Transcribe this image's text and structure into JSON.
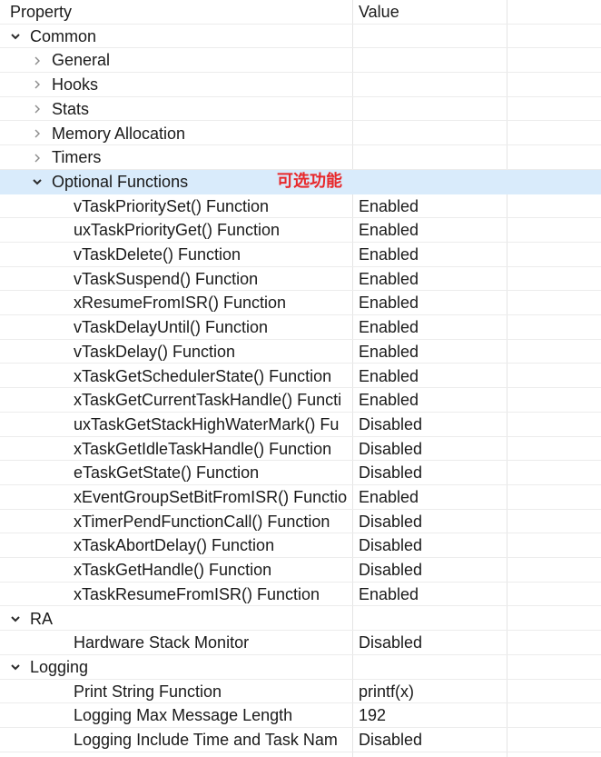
{
  "header": {
    "property": "Property",
    "value": "Value"
  },
  "annotation": {
    "text": "可选功能",
    "color": "#e8282b"
  },
  "rows": [
    {
      "label": "Common",
      "value": "",
      "depth": 0,
      "chevron": "expanded"
    },
    {
      "label": "General",
      "value": "",
      "depth": 1,
      "chevron": "collapsed"
    },
    {
      "label": "Hooks",
      "value": "",
      "depth": 1,
      "chevron": "collapsed"
    },
    {
      "label": "Stats",
      "value": "",
      "depth": 1,
      "chevron": "collapsed"
    },
    {
      "label": "Memory Allocation",
      "value": "",
      "depth": 1,
      "chevron": "collapsed"
    },
    {
      "label": "Timers",
      "value": "",
      "depth": 1,
      "chevron": "collapsed"
    },
    {
      "label": "Optional Functions",
      "value": "",
      "depth": 1,
      "chevron": "expanded",
      "selected": true
    },
    {
      "label": "vTaskPrioritySet() Function",
      "value": "Enabled",
      "depth": 2
    },
    {
      "label": "uxTaskPriorityGet() Function",
      "value": "Enabled",
      "depth": 2
    },
    {
      "label": "vTaskDelete() Function",
      "value": "Enabled",
      "depth": 2
    },
    {
      "label": "vTaskSuspend() Function",
      "value": "Enabled",
      "depth": 2
    },
    {
      "label": "xResumeFromISR() Function",
      "value": "Enabled",
      "depth": 2
    },
    {
      "label": "vTaskDelayUntil() Function",
      "value": "Enabled",
      "depth": 2
    },
    {
      "label": "vTaskDelay() Function",
      "value": "Enabled",
      "depth": 2
    },
    {
      "label": "xTaskGetSchedulerState() Function",
      "value": "Enabled",
      "depth": 2
    },
    {
      "label": "xTaskGetCurrentTaskHandle() Functi",
      "value": "Enabled",
      "depth": 2
    },
    {
      "label": "uxTaskGetStackHighWaterMark() Fu",
      "value": "Disabled",
      "depth": 2
    },
    {
      "label": "xTaskGetIdleTaskHandle() Function",
      "value": "Disabled",
      "depth": 2
    },
    {
      "label": "eTaskGetState() Function",
      "value": "Disabled",
      "depth": 2
    },
    {
      "label": "xEventGroupSetBitFromISR() Functio",
      "value": "Enabled",
      "depth": 2
    },
    {
      "label": "xTimerPendFunctionCall() Function",
      "value": "Disabled",
      "depth": 2
    },
    {
      "label": "xTaskAbortDelay() Function",
      "value": "Disabled",
      "depth": 2
    },
    {
      "label": "xTaskGetHandle() Function",
      "value": "Disabled",
      "depth": 2
    },
    {
      "label": "xTaskResumeFromISR() Function",
      "value": "Enabled",
      "depth": 2
    },
    {
      "label": "RA",
      "value": "",
      "depth": 0,
      "chevron": "expanded"
    },
    {
      "label": "Hardware Stack Monitor",
      "value": "Disabled",
      "depth": 2
    },
    {
      "label": "Logging",
      "value": "",
      "depth": 0,
      "chevron": "expanded"
    },
    {
      "label": "Print String Function",
      "value": "printf(x)",
      "depth": 2
    },
    {
      "label": "Logging Max Message Length",
      "value": "192",
      "depth": 2
    },
    {
      "label": "Logging Include Time and Task Nam",
      "value": "Disabled",
      "depth": 2
    }
  ]
}
